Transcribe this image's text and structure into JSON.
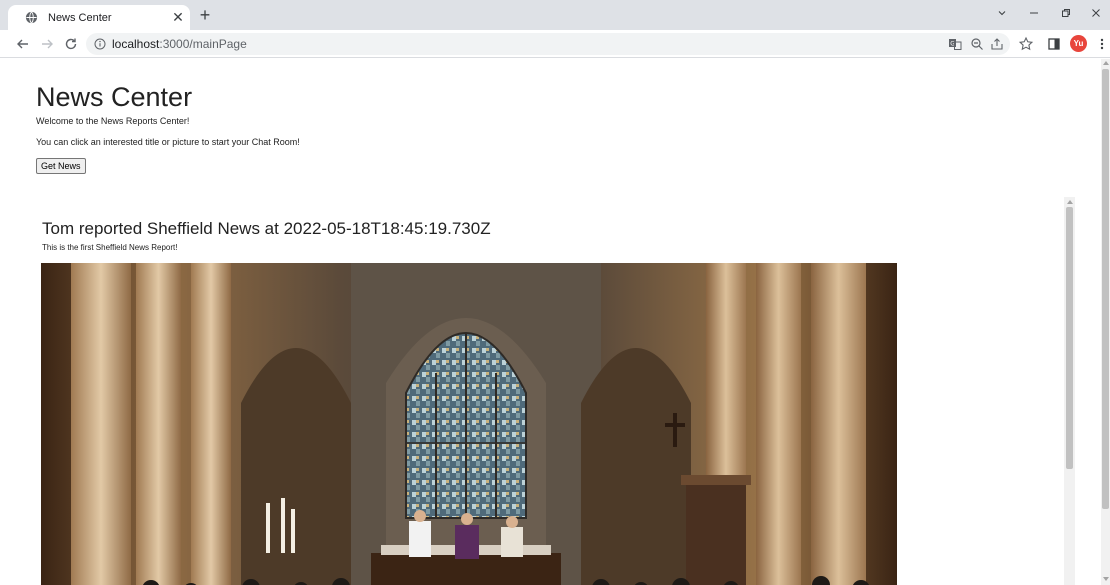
{
  "browser": {
    "tab": {
      "title": "News Center",
      "favicon": "globe-icon",
      "close_glyph": "✕"
    },
    "new_tab_glyph": "+",
    "address": {
      "host": "localhost",
      "path": ":3000/mainPage",
      "security_icon": "info-icon"
    },
    "profile_initials": "Yu",
    "colors": {
      "tabstrip": "#dee1e6",
      "omnibox": "#f1f3f4",
      "avatar": "#e8453c"
    }
  },
  "page": {
    "title": "News Center",
    "welcome": "Welcome to the News Reports Center!",
    "instructions": "You can click an interested title or picture to start your Chat Room!",
    "get_news_label": "Get News",
    "news": [
      {
        "title": "Tom reported Sheffield News at 2022-05-18T18:45:19.730Z",
        "description": "This is the first Sheffield News Report!",
        "image": "church-interior-photo"
      }
    ]
  }
}
